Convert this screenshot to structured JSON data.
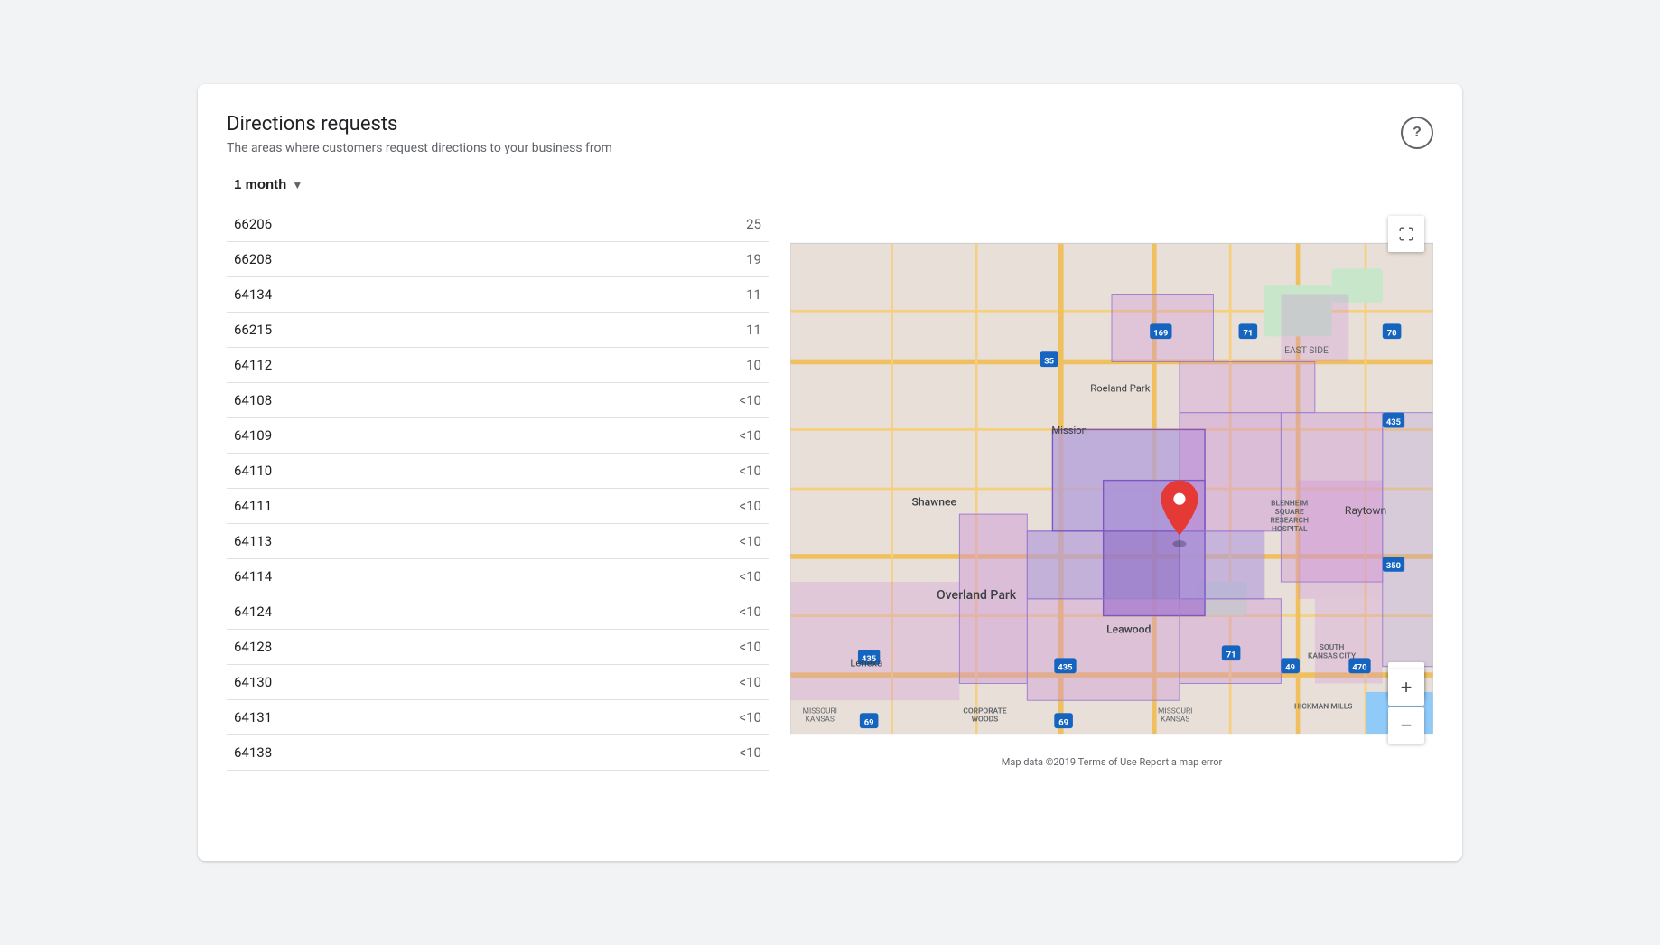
{
  "card": {
    "title": "Directions requests",
    "subtitle": "The areas where customers request directions to your business from",
    "help_label": "?"
  },
  "filter": {
    "label": "1 month",
    "arrow": "▼"
  },
  "table": {
    "rows": [
      {
        "zipcode": "66206",
        "count": "25"
      },
      {
        "zipcode": "66208",
        "count": "19"
      },
      {
        "zipcode": "64134",
        "count": "11"
      },
      {
        "zipcode": "66215",
        "count": "11"
      },
      {
        "zipcode": "64112",
        "count": "10"
      },
      {
        "zipcode": "64108",
        "count": "<10"
      },
      {
        "zipcode": "64109",
        "count": "<10"
      },
      {
        "zipcode": "64110",
        "count": "<10"
      },
      {
        "zipcode": "64111",
        "count": "<10"
      },
      {
        "zipcode": "64113",
        "count": "<10"
      },
      {
        "zipcode": "64114",
        "count": "<10"
      },
      {
        "zipcode": "64124",
        "count": "<10"
      },
      {
        "zipcode": "64128",
        "count": "<10"
      },
      {
        "zipcode": "64130",
        "count": "<10"
      },
      {
        "zipcode": "64131",
        "count": "<10"
      },
      {
        "zipcode": "64138",
        "count": "<10"
      }
    ]
  },
  "map": {
    "attribution": "Map data ©2019   Terms of Use   Report a map error",
    "zoom_in_label": "+",
    "zoom_out_label": "−",
    "places": [
      "Shawnee",
      "Mission",
      "Roeland Park",
      "Overland Park",
      "Leawood",
      "Lenexa",
      "Raytown",
      "EAST SIDE",
      "BLENHEIM SQUARE RESEARCH HOSPITAL",
      "SOUTH KANSAS CITY",
      "HICKMAN MILLS",
      "CORPORATE WOODS",
      "MISSOURI KANSAS"
    ],
    "roads": [
      "35",
      "69",
      "70",
      "71",
      "169",
      "435",
      "435",
      "350",
      "49",
      "470"
    ]
  }
}
